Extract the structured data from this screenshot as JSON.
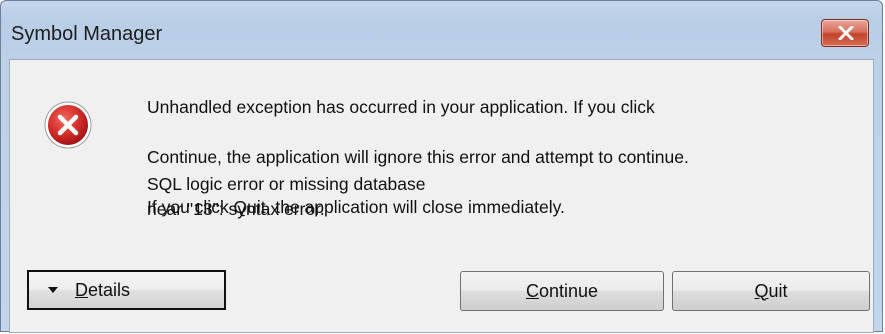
{
  "window": {
    "title": "Symbol Manager"
  },
  "message": {
    "line1": "Unhandled exception has occurred in your application. If you click",
    "line2": "Continue, the application will ignore this error and attempt to continue.",
    "line3": "If you click Quit, the application will close immediately.",
    "detail_line1": "SQL logic error or missing database",
    "detail_line2": "near \"13\": syntax error."
  },
  "buttons": {
    "details": {
      "first": "D",
      "rest": "etails"
    },
    "continue": {
      "first": "C",
      "rest": "ontinue"
    },
    "quit": {
      "first": "Q",
      "rest": "uit"
    }
  },
  "icons": {
    "close": "close-icon",
    "error": "error-icon",
    "details_caret": "caret-down-icon"
  },
  "colors": {
    "close_button": "#c4432c",
    "error_icon": "#c8262a"
  }
}
